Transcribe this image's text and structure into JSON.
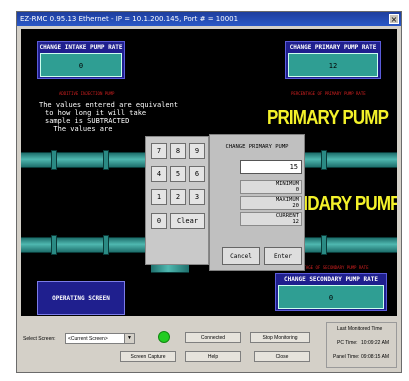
{
  "window": {
    "title": "EZ-RMC 0.95.13 Ethernet - IP = 10.1.200.145, Port # = 10001",
    "close_glyph": "×"
  },
  "hmi": {
    "intake_panel": {
      "label": "CHANGE INTAKE PUMP RATE",
      "value": "0"
    },
    "primary_panel": {
      "label": "CHANGE PRIMARY PUMP RATE",
      "value": "12"
    },
    "secondary_panel": {
      "label": "CHANGE SECONDARY PUMP RATE",
      "value": "0"
    },
    "red_note_left": "ADDITIVE INJECTION PUMP",
    "red_note_right": "PERCENTAGE OF PRIMARY PUMP RATE",
    "red_note_bottom_right": "PERCENTAGE OF SECONDARY PUMP RATE",
    "primary_pump_title": "PRIMARY PUMP",
    "secondary_pump_title": "SECONDARY PUMP",
    "info_lines": [
      "The values entered are equivalent",
      "to how long it will take",
      "sample is SUBTRACTED",
      "  The values are"
    ],
    "operating_screen_btn": "OPERATING SCREEN"
  },
  "keypad": {
    "keys": [
      "7",
      "8",
      "9",
      "4",
      "5",
      "6",
      "1",
      "2",
      "3",
      "0"
    ],
    "clear_label": "Clear"
  },
  "dialog": {
    "title": "CHANGE PRIMARY PUMP",
    "input_value": "15",
    "minimum_label": "MINIMUM",
    "minimum_value": "0",
    "maximum_label": "MAXIMUM",
    "maximum_value": "20",
    "current_label": "CURRENT",
    "current_value": "12",
    "cancel_label": "Cancel",
    "enter_label": "Enter"
  },
  "controls": {
    "select_screen_label": "Select Screen:",
    "select_screen_value": "<Current Screen>",
    "connected_label": "Connected",
    "stop_monitoring_label": "Stop Monitoring",
    "screen_capture_label": "Screen Capture",
    "help_label": "Help",
    "close_label": "Close",
    "last_monitored_label": "Last Monitored Time",
    "pc_time_label": "PC Time:",
    "pc_time_value": "10:09:22 AM",
    "panel_time_label": "Panel Time:",
    "panel_time_value": "09:08:15 AM",
    "status_color": "#22cc22"
  }
}
